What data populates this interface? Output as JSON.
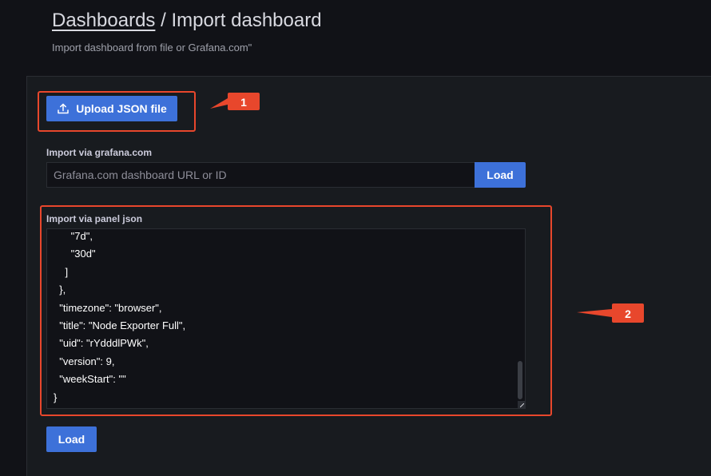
{
  "header": {
    "breadcrumb_parent": "Dashboards",
    "separator": " / ",
    "title": "Import dashboard",
    "subtitle": "Import dashboard from file or Grafana.com\""
  },
  "upload": {
    "label": "Upload JSON file",
    "icon": "upload-icon"
  },
  "grafana_import": {
    "label": "Import via grafana.com",
    "placeholder": "Grafana.com dashboard URL or ID",
    "value": "",
    "load_label": "Load"
  },
  "json_import": {
    "label": "Import via panel json",
    "visible_text": "      \"7d\",\n      \"30d\"\n    ]\n  },\n  \"timezone\": \"browser\",\n  \"title\": \"Node Exporter Full\",\n  \"uid\": \"rYdddlPWk\",\n  \"version\": 9,\n  \"weekStart\": \"\"\n}",
    "load_label": "Load"
  },
  "annotations": {
    "marker_1": "1",
    "marker_2": "2",
    "highlight_color": "#e8472c"
  },
  "colors": {
    "background": "#111217",
    "panel": "#181b1f",
    "primary_button": "#3d71d9",
    "annotation": "#e8472c"
  }
}
